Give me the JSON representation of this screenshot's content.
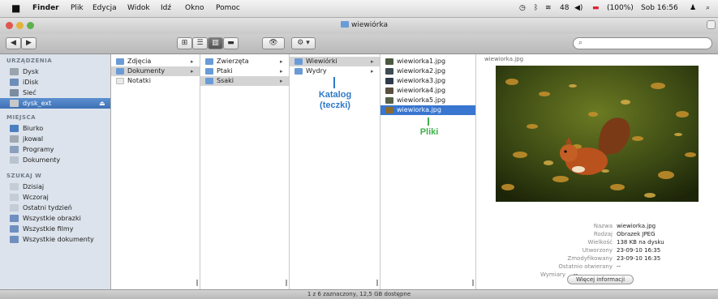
{
  "menubar": {
    "items": [
      "Finder",
      "Plik",
      "Edycja",
      "Widok",
      "Idź",
      "Okno",
      "Pomoc"
    ],
    "status": {
      "battery": "(100%)",
      "date_time": "Sob 16:56",
      "user": "",
      "percent": "48"
    }
  },
  "window": {
    "title": "wiewiórka"
  },
  "toolbar": {
    "back": "◀",
    "forward": "▶",
    "view_icons": "⊞",
    "view_list": "☰",
    "view_columns": "▥",
    "view_cover": "▬",
    "quicklook": "👁",
    "action": "⚙ ▾",
    "search_placeholder": ""
  },
  "sidebar": {
    "sections": [
      {
        "title": "URZĄDZENIA",
        "items": [
          {
            "label": "Dysk",
            "icon": "hard-drive-icon"
          },
          {
            "label": "iDisk",
            "icon": "idisk-icon"
          },
          {
            "label": "Sieć",
            "icon": "network-icon"
          },
          {
            "label": "dysk_ext",
            "icon": "external-drive-icon",
            "selected": true
          }
        ]
      },
      {
        "title": "MIEJSCA",
        "items": [
          {
            "label": "Biurko",
            "icon": "desktop-icon"
          },
          {
            "label": "jkowal",
            "icon": "home-icon"
          },
          {
            "label": "Programy",
            "icon": "applications-icon"
          },
          {
            "label": "Dokumenty",
            "icon": "documents-icon"
          }
        ]
      },
      {
        "title": "SZUKAJ W",
        "items": [
          {
            "label": "Dzisiaj",
            "icon": "clock-icon"
          },
          {
            "label": "Wczoraj",
            "icon": "clock-icon"
          },
          {
            "label": "Ostatni tydzień",
            "icon": "clock-icon"
          },
          {
            "label": "Wszystkie obrazki",
            "icon": "smart-folder-icon"
          },
          {
            "label": "Wszystkie filmy",
            "icon": "smart-folder-icon"
          },
          {
            "label": "Wszystkie dokumenty",
            "icon": "smart-folder-icon"
          }
        ]
      }
    ]
  },
  "columns": [
    [
      {
        "label": "Zdjęcia",
        "folder": true,
        "arrow": true
      },
      {
        "label": "Dokumenty",
        "folder": true,
        "arrow": true,
        "selected": true
      },
      {
        "label": "Notatki",
        "folder": false
      }
    ],
    [
      {
        "label": "Zwierzęta",
        "folder": true,
        "arrow": true
      },
      {
        "label": "Ptaki",
        "folder": true,
        "arrow": true
      },
      {
        "label": "Ssaki",
        "folder": true,
        "arrow": true,
        "selected": true
      }
    ],
    [
      {
        "label": "Wiewiórki",
        "folder": true,
        "arrow": true,
        "selected": true
      },
      {
        "label": "Wydry",
        "folder": true,
        "arrow": true
      }
    ],
    [
      {
        "label": "wiewiorka1.jpg"
      },
      {
        "label": "wiewiorka2.jpg"
      },
      {
        "label": "wiewiorka3.jpg"
      },
      {
        "label": "wiewiorka4.jpg"
      },
      {
        "label": "wiewiorka5.jpg"
      },
      {
        "label": "wiewiorka.jpg",
        "selected": true
      }
    ]
  ],
  "annotations": {
    "folders": "Katalog\n(teczki)",
    "files": "Pliki"
  },
  "preview": {
    "name": "wiewiorka.jpg",
    "meta": [
      {
        "k": "Nazwa",
        "v": "wiewiorka.jpg"
      },
      {
        "k": "Rodzaj",
        "v": "Obrazek JPEG"
      },
      {
        "k": "Wielkość",
        "v": "138 KB na dysku"
      },
      {
        "k": "Utworzony",
        "v": "23-09-10 16:35"
      },
      {
        "k": "Zmodyfikowany",
        "v": "23-09-10 16:35"
      },
      {
        "k": "Ostatnio otwierany",
        "v": "--"
      },
      {
        "k": "Wymiary",
        "v": "--"
      }
    ],
    "more_button": "Więcej informacji"
  },
  "statusbar": "1 z 6 zaznaczony, 12,5 GB dostępne",
  "colors": {
    "accent": "#3876d0",
    "annotation_blue": "#2f79c8",
    "annotation_green": "#3fb14a"
  }
}
